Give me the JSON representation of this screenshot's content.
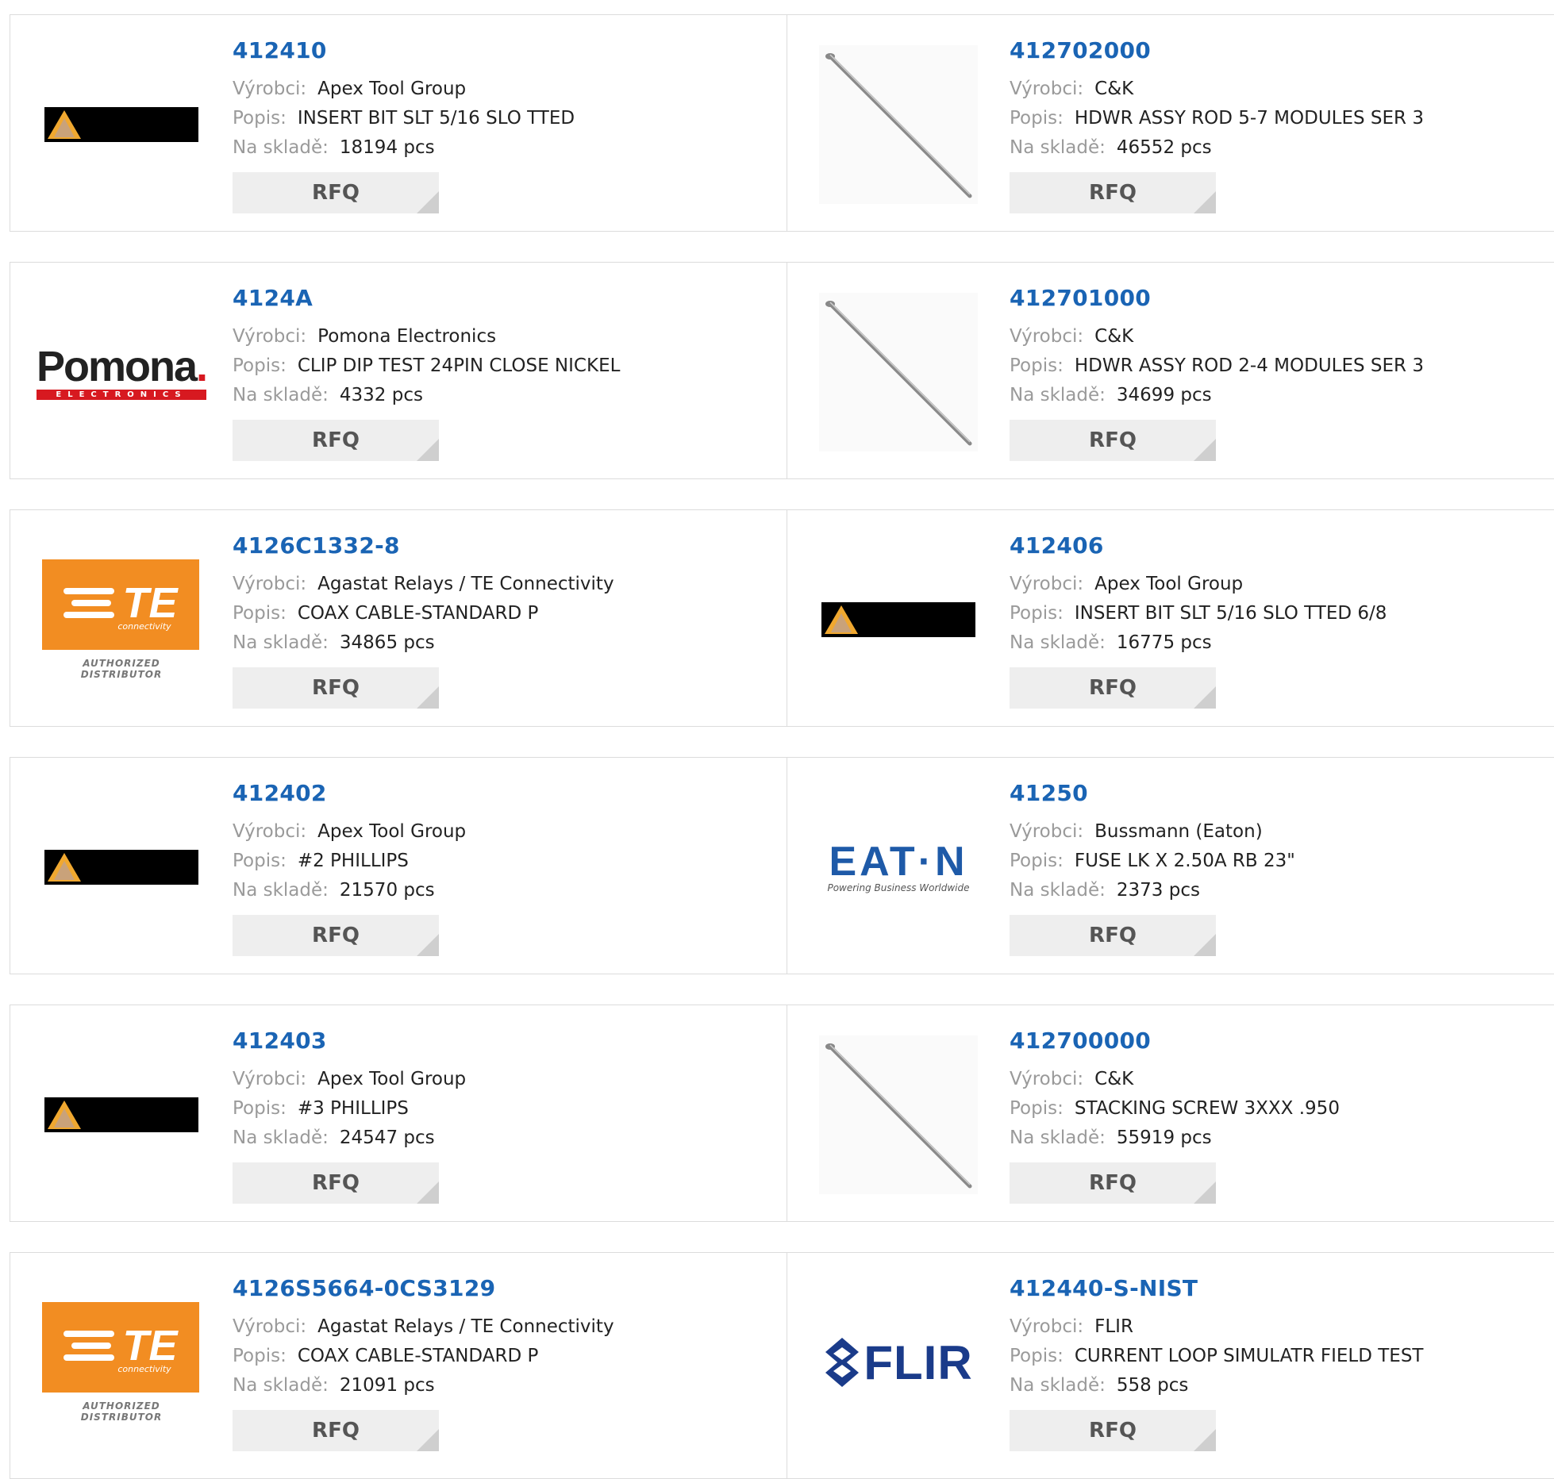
{
  "labels": {
    "manufacturer": "Výrobci:",
    "description": "Popis:",
    "stock": "Na skladě:",
    "rfq": "RFQ"
  },
  "products": [
    {
      "part": "412410",
      "manufacturer": "Apex Tool Group",
      "description": "INSERT BIT SLT 5/16 SLO TTED",
      "stock": "18194 pcs",
      "logo": "apex"
    },
    {
      "part": "412702000",
      "manufacturer": "C&K",
      "description": "HDWR ASSY ROD 5-7 MODULES SER 3",
      "stock": "46552 pcs",
      "logo": "rod"
    },
    {
      "part": "4124A",
      "manufacturer": "Pomona Electronics",
      "description": "CLIP DIP TEST 24PIN CLOSE NICKEL",
      "stock": "4332 pcs",
      "logo": "pomona"
    },
    {
      "part": "412701000",
      "manufacturer": "C&K",
      "description": "HDWR ASSY ROD 2-4 MODULES SER 3",
      "stock": "34699 pcs",
      "logo": "rod"
    },
    {
      "part": "4126C1332-8",
      "manufacturer": "Agastat Relays / TE Connectivity",
      "description": "COAX CABLE-STANDARD P",
      "stock": "34865 pcs",
      "logo": "te"
    },
    {
      "part": "412406",
      "manufacturer": "Apex Tool Group",
      "description": "INSERT BIT SLT 5/16 SLO TTED 6/8",
      "stock": "16775 pcs",
      "logo": "apex"
    },
    {
      "part": "412402",
      "manufacturer": "Apex Tool Group",
      "description": "#2 PHILLIPS",
      "stock": "21570 pcs",
      "logo": "apex"
    },
    {
      "part": "41250",
      "manufacturer": "Bussmann (Eaton)",
      "description": "FUSE LK X 2.50A RB 23\"",
      "stock": "2373 pcs",
      "logo": "eaton"
    },
    {
      "part": "412403",
      "manufacturer": "Apex Tool Group",
      "description": "#3 PHILLIPS",
      "stock": "24547 pcs",
      "logo": "apex"
    },
    {
      "part": "412700000",
      "manufacturer": "C&K",
      "description": "STACKING SCREW 3XXX .950",
      "stock": "55919 pcs",
      "logo": "rod"
    },
    {
      "part": "4126S5664-0CS3129",
      "manufacturer": "Agastat Relays / TE Connectivity",
      "description": "COAX CABLE-STANDARD P",
      "stock": "21091 pcs",
      "logo": "te"
    },
    {
      "part": "412440-S-NIST",
      "manufacturer": "FLIR",
      "description": "CURRENT LOOP SIMULATR FIELD TEST",
      "stock": "558 pcs",
      "logo": "flir"
    }
  ],
  "logo_text": {
    "pomona_word": "Pomona",
    "pomona_dot": ".",
    "pomona_sub": "ELECTRONICS",
    "te_word": "TE",
    "te_sub": "connectivity",
    "te_auth": "AUTHORIZED DISTRIBUTOR",
    "eaton_word": "EAT·N",
    "eaton_sub": "Powering Business Worldwide",
    "flir_word": "FLIR"
  },
  "colors": {
    "link": "#1a64b4",
    "label": "#9a9a9a",
    "te_orange": "#f28d22",
    "eaton_blue": "#1e5aa8",
    "flir_blue": "#1a3b8a",
    "pomona_red": "#d71920"
  }
}
